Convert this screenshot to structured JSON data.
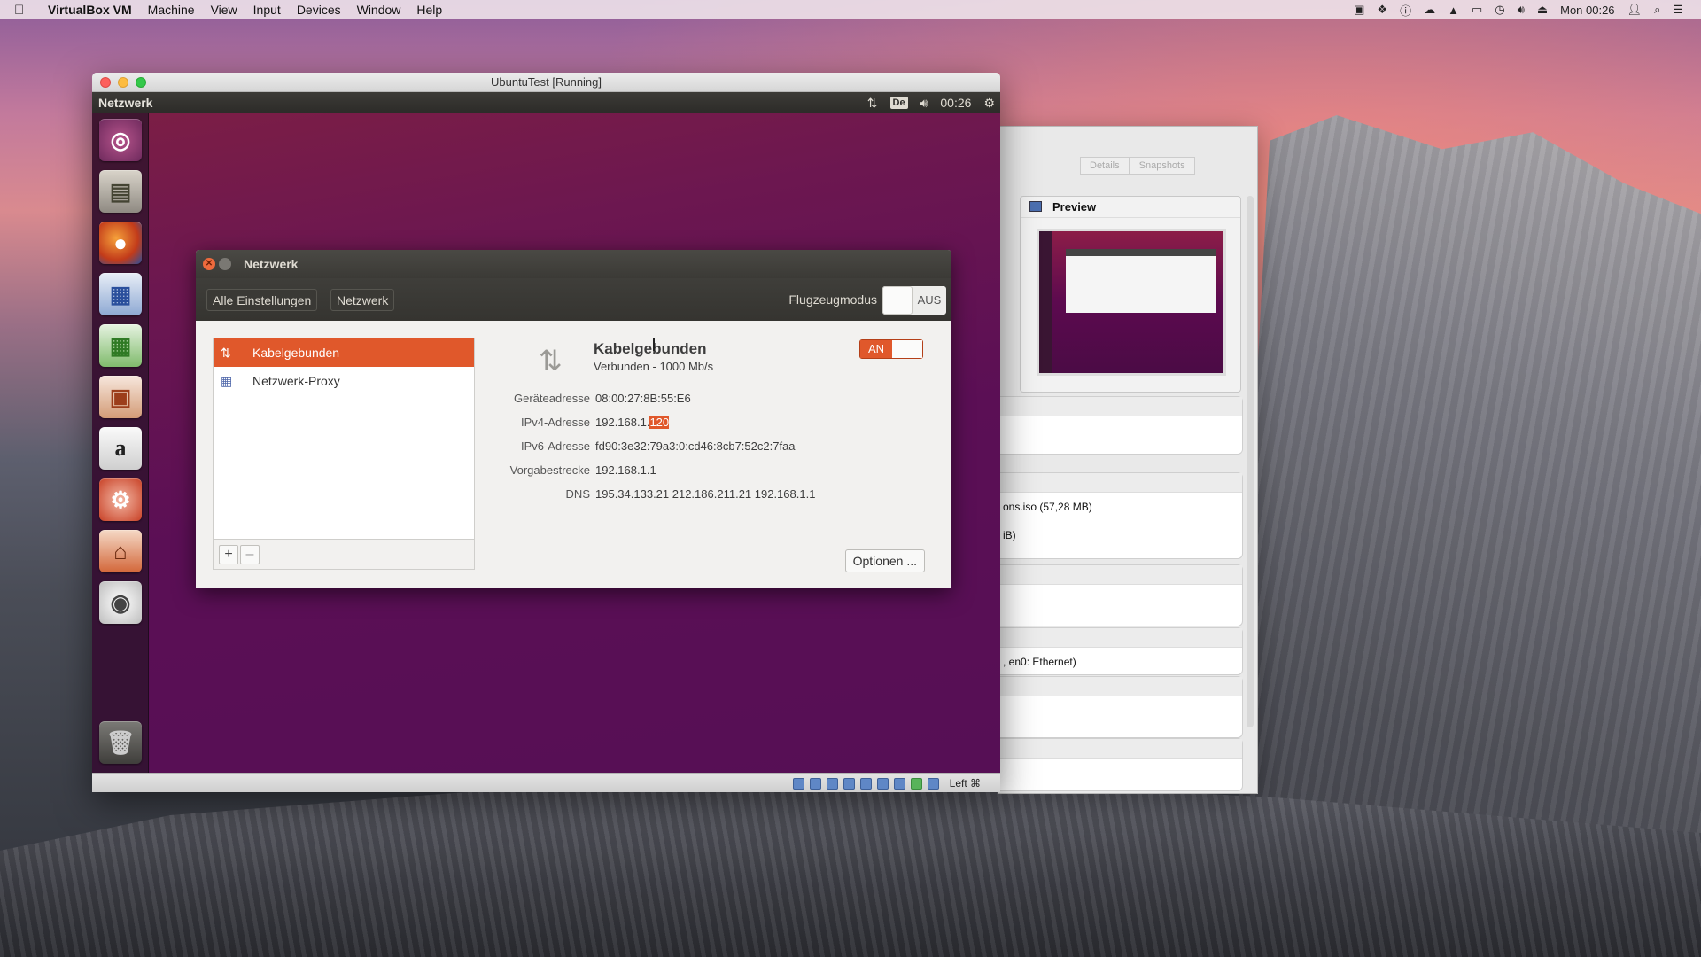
{
  "menubar": {
    "app_name": "VirtualBox VM",
    "items": [
      "Machine",
      "View",
      "Input",
      "Devices",
      "Window",
      "Help"
    ],
    "clock": "Mon 00:26"
  },
  "vbox_manager": {
    "tabs": [
      "Details",
      "Snapshots"
    ],
    "preview_title": "Preview",
    "lines": [
      "ons.iso (57,28 MB)",
      "iB)",
      ", en0: Ethernet)"
    ]
  },
  "vm_window": {
    "title": "UbuntuTest [Running]",
    "status_host_key": "Left ⌘"
  },
  "ubuntu_panel": {
    "title": "Netzwerk",
    "keyboard": "De",
    "clock": "00:26"
  },
  "net_dialog": {
    "title": "Netzwerk",
    "crumbs": [
      "Alle Einstellungen",
      "Netzwerk"
    ],
    "airplane_label": "Flugzeugmodus",
    "airplane_state": "AUS",
    "connections": [
      {
        "label": "Kabelgebunden",
        "icon": "network-wired-icon"
      },
      {
        "label": "Netzwerk-Proxy",
        "icon": "network-proxy-icon"
      }
    ],
    "add_label": "+",
    "remove_label": "–",
    "detail": {
      "name": "Kabelgebunden",
      "status": "Verbunden - 1000 Mb/s",
      "switch_state": "AN",
      "rows": [
        {
          "key": "Geräteadresse",
          "value": "08:00:27:8B:55:E6"
        },
        {
          "key": "IPv4-Adresse",
          "value": "192.168.1.",
          "highlight": "120"
        },
        {
          "key": "IPv6-Adresse",
          "value": "fd90:3e32:79a3:0:cd46:8cb7:52c2:7faa"
        },
        {
          "key": "Vorgabestrecke",
          "value": "192.168.1.1"
        },
        {
          "key": "DNS",
          "value": "195.34.133.21 212.186.211.21 192.168.1.1"
        }
      ],
      "options_label": "Optionen ..."
    }
  },
  "colors": {
    "ubuntu_orange": "#e0582b",
    "ubuntu_panel": "#3c3b37",
    "guest_bg": "#5b0f55"
  }
}
